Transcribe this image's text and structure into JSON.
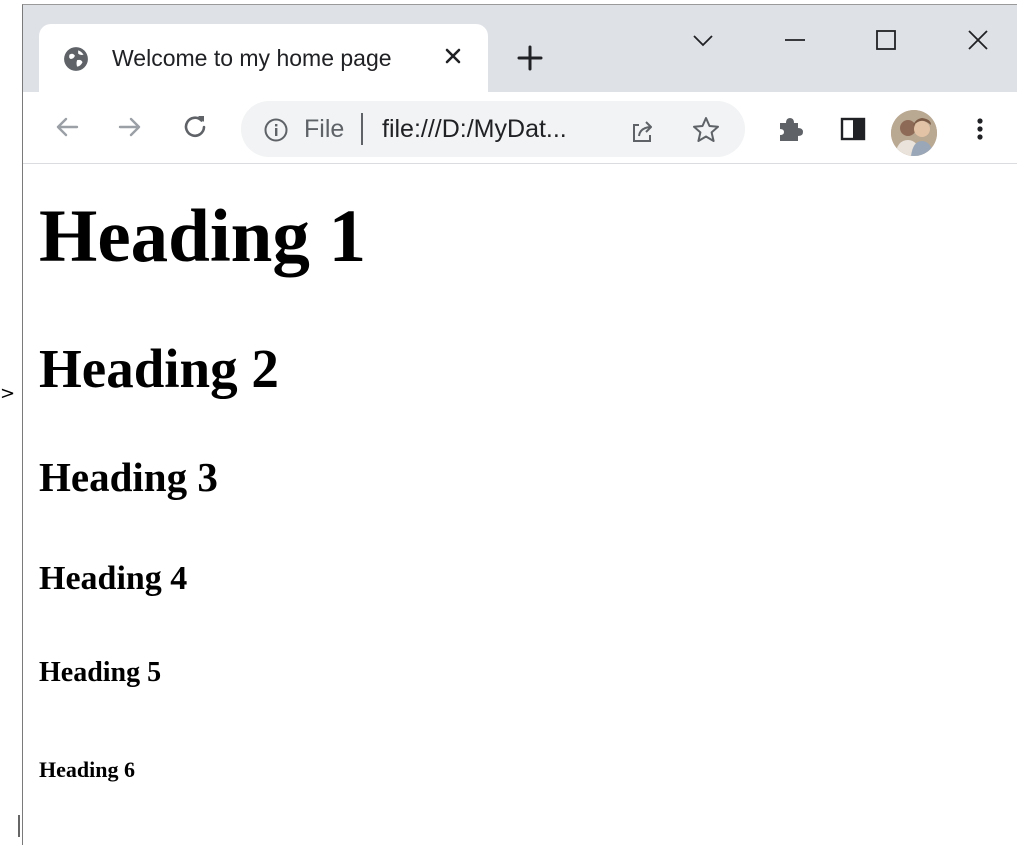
{
  "browser": {
    "tab": {
      "title": "Welcome to my home page",
      "favicon_icon": "globe-icon",
      "close_icon": "close-icon"
    },
    "new_tab_icon": "plus-icon",
    "window_controls": [
      "chevron-down-icon",
      "minimize-icon",
      "maximize-icon",
      "close-icon"
    ],
    "toolbar": {
      "back_icon": "arrow-left-icon",
      "forward_icon": "arrow-right-icon",
      "reload_icon": "reload-icon",
      "omnibox": {
        "scheme_label": "File",
        "url": "file:///D:/MyDat...",
        "info_icon": "info-icon",
        "share_icon": "share-icon",
        "bookmark_icon": "star-icon"
      },
      "extensions_icon": "puzzle-icon",
      "side_panel_icon": "side-panel-icon",
      "menu_icon": "more-vert-icon"
    }
  },
  "page": {
    "headings": {
      "h1": "Heading 1",
      "h2": "Heading 2",
      "h3": "Heading 3",
      "h4": "Heading 4",
      "h5": "Heading 5",
      "h6": "Heading 6"
    }
  },
  "outside": {
    "arrow_glyph": ">"
  },
  "colors": {
    "tabstrip": "#dee1e6",
    "omnibox": "#f1f3f4",
    "icon": "#5f6368",
    "text": "#202124"
  }
}
